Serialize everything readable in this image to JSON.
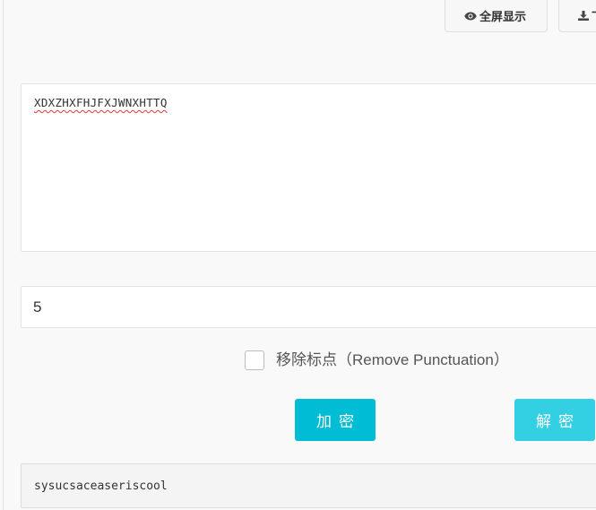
{
  "toolbar": {
    "fullscreen_label": "全屏显示",
    "download_label": "下载",
    "fullscreen_icon": "eye-icon",
    "download_icon": "download-icon"
  },
  "input": {
    "value": "XDXZHXFHJFXJWNXHTTQ"
  },
  "key": {
    "value": "5"
  },
  "options": {
    "remove_punctuation_label": "移除标点（Remove Punctuation）",
    "remove_punctuation_checked": false
  },
  "actions": {
    "encrypt_label": "加密",
    "decrypt_label": "解密"
  },
  "output": {
    "value": "sysucsaceaseriscool"
  },
  "colors": {
    "accent": "#00bcd4",
    "accent_light": "#33cfe3"
  }
}
